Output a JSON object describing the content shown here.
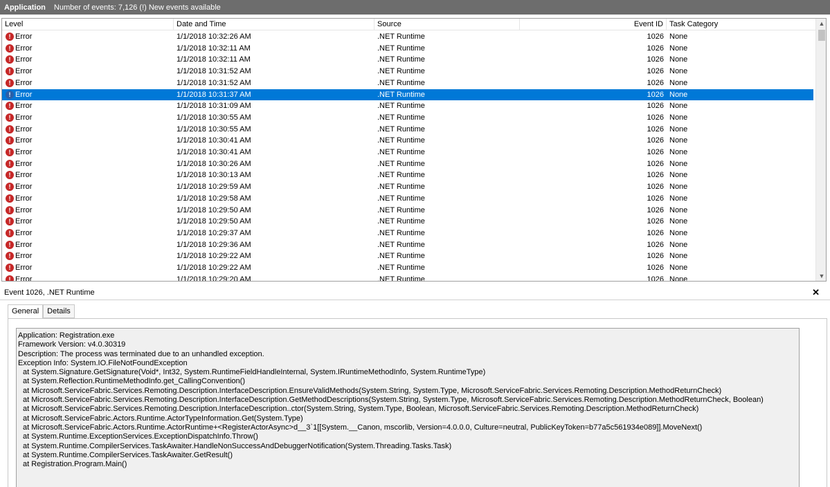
{
  "titlebar": {
    "app": "Application",
    "info": "Number of events: 7,126 (!) New events available"
  },
  "grid": {
    "columns": [
      "Level",
      "Date and Time",
      "Source",
      "Event ID",
      "Task Category"
    ],
    "selected_index": 5,
    "rows": [
      {
        "level": "Error",
        "datetime": "1/1/2018 10:32:26 AM",
        "source": ".NET Runtime",
        "event_id": "1026",
        "task": "None"
      },
      {
        "level": "Error",
        "datetime": "1/1/2018 10:32:11 AM",
        "source": ".NET Runtime",
        "event_id": "1026",
        "task": "None"
      },
      {
        "level": "Error",
        "datetime": "1/1/2018 10:32:11 AM",
        "source": ".NET Runtime",
        "event_id": "1026",
        "task": "None"
      },
      {
        "level": "Error",
        "datetime": "1/1/2018 10:31:52 AM",
        "source": ".NET Runtime",
        "event_id": "1026",
        "task": "None"
      },
      {
        "level": "Error",
        "datetime": "1/1/2018 10:31:52 AM",
        "source": ".NET Runtime",
        "event_id": "1026",
        "task": "None"
      },
      {
        "level": "Error",
        "datetime": "1/1/2018 10:31:37 AM",
        "source": ".NET Runtime",
        "event_id": "1026",
        "task": "None"
      },
      {
        "level": "Error",
        "datetime": "1/1/2018 10:31:09 AM",
        "source": ".NET Runtime",
        "event_id": "1026",
        "task": "None"
      },
      {
        "level": "Error",
        "datetime": "1/1/2018 10:30:55 AM",
        "source": ".NET Runtime",
        "event_id": "1026",
        "task": "None"
      },
      {
        "level": "Error",
        "datetime": "1/1/2018 10:30:55 AM",
        "source": ".NET Runtime",
        "event_id": "1026",
        "task": "None"
      },
      {
        "level": "Error",
        "datetime": "1/1/2018 10:30:41 AM",
        "source": ".NET Runtime",
        "event_id": "1026",
        "task": "None"
      },
      {
        "level": "Error",
        "datetime": "1/1/2018 10:30:41 AM",
        "source": ".NET Runtime",
        "event_id": "1026",
        "task": "None"
      },
      {
        "level": "Error",
        "datetime": "1/1/2018 10:30:26 AM",
        "source": ".NET Runtime",
        "event_id": "1026",
        "task": "None"
      },
      {
        "level": "Error",
        "datetime": "1/1/2018 10:30:13 AM",
        "source": ".NET Runtime",
        "event_id": "1026",
        "task": "None"
      },
      {
        "level": "Error",
        "datetime": "1/1/2018 10:29:59 AM",
        "source": ".NET Runtime",
        "event_id": "1026",
        "task": "None"
      },
      {
        "level": "Error",
        "datetime": "1/1/2018 10:29:58 AM",
        "source": ".NET Runtime",
        "event_id": "1026",
        "task": "None"
      },
      {
        "level": "Error",
        "datetime": "1/1/2018 10:29:50 AM",
        "source": ".NET Runtime",
        "event_id": "1026",
        "task": "None"
      },
      {
        "level": "Error",
        "datetime": "1/1/2018 10:29:50 AM",
        "source": ".NET Runtime",
        "event_id": "1026",
        "task": "None"
      },
      {
        "level": "Error",
        "datetime": "1/1/2018 10:29:37 AM",
        "source": ".NET Runtime",
        "event_id": "1026",
        "task": "None"
      },
      {
        "level": "Error",
        "datetime": "1/1/2018 10:29:36 AM",
        "source": ".NET Runtime",
        "event_id": "1026",
        "task": "None"
      },
      {
        "level": "Error",
        "datetime": "1/1/2018 10:29:22 AM",
        "source": ".NET Runtime",
        "event_id": "1026",
        "task": "None"
      },
      {
        "level": "Error",
        "datetime": "1/1/2018 10:29:22 AM",
        "source": ".NET Runtime",
        "event_id": "1026",
        "task": "None"
      },
      {
        "level": "Error",
        "datetime": "1/1/2018 10:29:20 AM",
        "source": ".NET Runtime",
        "event_id": "1026",
        "task": "None"
      }
    ]
  },
  "detail": {
    "title": "Event 1026, .NET Runtime",
    "close_glyph": "✕",
    "tabs": [
      "General",
      "Details"
    ],
    "lines": [
      "Application: Registration.exe",
      "Framework Version: v4.0.30319",
      "Description: The process was terminated due to an unhandled exception.",
      "Exception Info: System.IO.FileNotFoundException",
      "at System.Signature.GetSignature(Void*, Int32, System.RuntimeFieldHandleInternal, System.IRuntimeMethodInfo, System.RuntimeType)",
      "at System.Reflection.RuntimeMethodInfo.get_CallingConvention()",
      "at Microsoft.ServiceFabric.Services.Remoting.Description.InterfaceDescription.EnsureValidMethods(System.String, System.Type, Microsoft.ServiceFabric.Services.Remoting.Description.MethodReturnCheck)",
      "at Microsoft.ServiceFabric.Services.Remoting.Description.InterfaceDescription.GetMethodDescriptions(System.String, System.Type, Microsoft.ServiceFabric.Services.Remoting.Description.MethodReturnCheck, Boolean)",
      "at Microsoft.ServiceFabric.Services.Remoting.Description.InterfaceDescription..ctor(System.String, System.Type, Boolean, Microsoft.ServiceFabric.Services.Remoting.Description.MethodReturnCheck)",
      "at Microsoft.ServiceFabric.Actors.Runtime.ActorTypeInformation.Get(System.Type)",
      "at Microsoft.ServiceFabric.Actors.Runtime.ActorRuntime+<RegisterActorAsync>d__3`1[[System.__Canon, mscorlib, Version=4.0.0.0, Culture=neutral, PublicKeyToken=b77a5c561934e089]].MoveNext()",
      "at System.Runtime.ExceptionServices.ExceptionDispatchInfo.Throw()",
      "at System.Runtime.CompilerServices.TaskAwaiter.HandleNonSuccessAndDebuggerNotification(System.Threading.Tasks.Task)",
      "at System.Runtime.CompilerServices.TaskAwaiter.GetResult()",
      "at Registration.Program.Main()"
    ]
  },
  "colors": {
    "titlebar_bg": "#6d6d6d",
    "selection": "#0078d7",
    "error_icon": "#c62828"
  },
  "icons": {
    "level": "error-icon",
    "scroll_up": "chevron-up-icon",
    "scroll_down": "chevron-down-icon"
  }
}
